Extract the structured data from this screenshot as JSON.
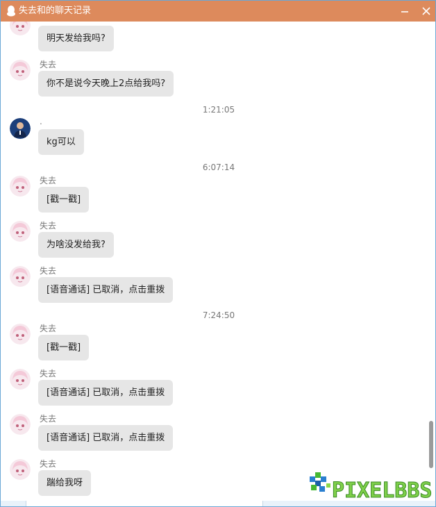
{
  "window": {
    "title": "失去和的聊天记录"
  },
  "colors": {
    "titlebar": "#dd8a5c",
    "bubble": "#e6e6e6"
  },
  "messages": [
    {
      "sender": "",
      "text": "明天发给我吗?",
      "avatar": "anime-girl-avatar"
    },
    {
      "sender": "失去",
      "text": "你不是说今天晚上2点给我吗?",
      "avatar": "anime-girl-avatar"
    },
    {
      "sender": ".",
      "text": "kg可以",
      "avatar": "person-photo-avatar"
    },
    {
      "sender": "失去",
      "text": "[戳一戳]",
      "avatar": "anime-girl-avatar"
    },
    {
      "sender": "失去",
      "text": "为啥没发给我?",
      "avatar": "anime-girl-avatar"
    },
    {
      "sender": "失去",
      "text": "[语音通话] 已取消，点击重拨",
      "avatar": "anime-girl-avatar"
    },
    {
      "sender": "失去",
      "text": "[戳一戳]",
      "avatar": "anime-girl-avatar"
    },
    {
      "sender": "失去",
      "text": "[语音通话] 已取消，点击重拨",
      "avatar": "anime-girl-avatar"
    },
    {
      "sender": "失去",
      "text": "[语音通话] 已取消，点击重拨",
      "avatar": "anime-girl-avatar"
    },
    {
      "sender": "失去",
      "text": "踹给我呀",
      "avatar": "anime-girl-avatar"
    }
  ],
  "timestamps": [
    "1:21:05",
    "6:07:14",
    "7:24:50"
  ],
  "watermark": {
    "text": "PIXELBBS"
  }
}
